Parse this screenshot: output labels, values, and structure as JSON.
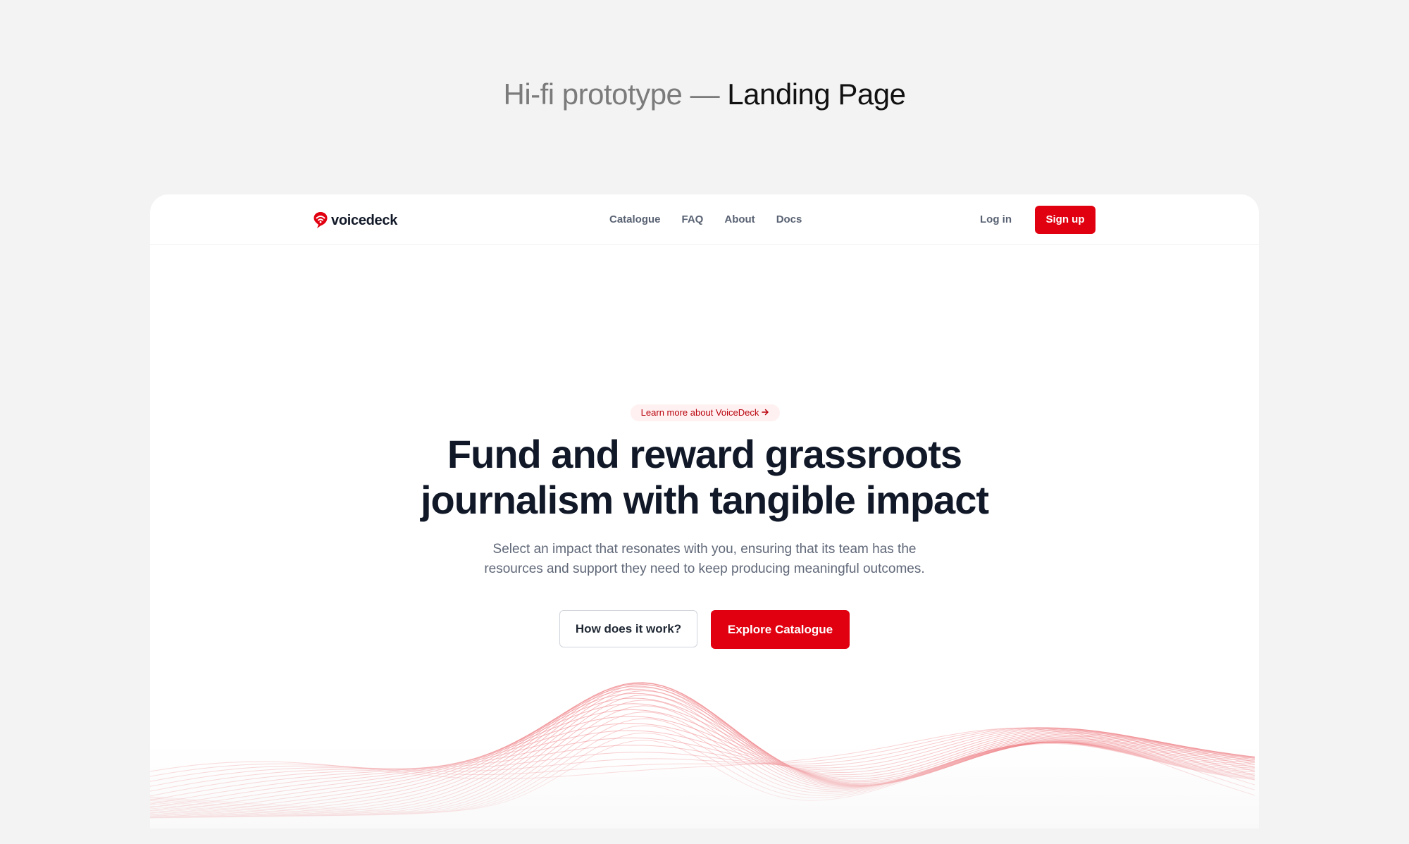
{
  "heading": {
    "prefix": "Hi-fi prototype — ",
    "title": "Landing Page"
  },
  "brand": {
    "name": "voicedeck",
    "logo_icon": "voicedeck-logo-icon",
    "color": "#e1000f"
  },
  "nav": {
    "links": [
      "Catalogue",
      "FAQ",
      "About",
      "Docs"
    ],
    "login_label": "Log in",
    "signup_label": "Sign up"
  },
  "hero": {
    "pill_label": "Learn more about VoiceDeck",
    "pill_icon": "arrow-right-icon",
    "title_lines": [
      "Fund and reward grassroots",
      "journalism with tangible impact"
    ],
    "subtitle_lines": [
      "Select an impact that resonates with you, ensuring that its team has the",
      "resources and support they need to keep producing meaningful outcomes."
    ],
    "secondary_button": "How does it work?",
    "primary_button": "Explore Catalogue"
  },
  "colors": {
    "accent": "#e1000f",
    "text": "#111827",
    "muted": "#5f6777",
    "wave": "#f08a8f"
  }
}
